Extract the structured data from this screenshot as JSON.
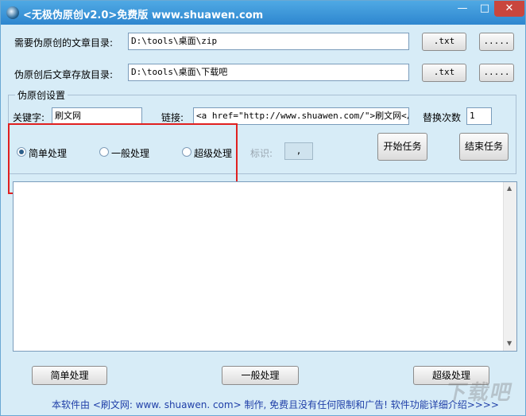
{
  "window": {
    "title": "<无极伪原创v2.0>免费版 www.shuawen.com",
    "min_glyph": "—",
    "max_glyph": "□",
    "close_glyph": "✕"
  },
  "rows": {
    "source_dir": {
      "label": "需要伪原创的文章目录:",
      "value": "D:\\tools\\桌面\\zip",
      "ext": ".txt",
      "browse": "....."
    },
    "output_dir": {
      "label": "伪原创后文章存放目录:",
      "value": "D:\\tools\\桌面\\下载吧",
      "ext": ".txt",
      "browse": "....."
    }
  },
  "settings": {
    "group_title": "伪原创设置",
    "keyword_label": "关键字:",
    "keyword_value": "刷文网",
    "link_label": "链接:",
    "link_value": "<a href=\"http://www.shuawen.com/\">刷文网</a>",
    "replace_label": "替换次数",
    "replace_value": "1",
    "mode_simple": "简单处理",
    "mode_normal": "一般处理",
    "mode_super": "超级处理",
    "mark_label": "标识:",
    "mark_value": ",",
    "selected_mode": "简单处理",
    "start_button": "开始任务",
    "stop_button": "结束任务"
  },
  "log": {
    "text": "",
    "up_arrow": "▲",
    "down_arrow": "▼"
  },
  "bottom": {
    "simple": "简单处理",
    "normal": "一般处理",
    "super": "超级处理"
  },
  "footer": "本软件由 <刷文网: www. shuawen. com> 制作, 免费且没有任何限制和广告! 软件功能详细介绍>>>>",
  "watermark": "下载吧",
  "colors": {
    "titlebar": "#2e86cf",
    "body": "#d7ecf7",
    "footer_text": "#1f3fa8",
    "highlight": "#e02020"
  }
}
